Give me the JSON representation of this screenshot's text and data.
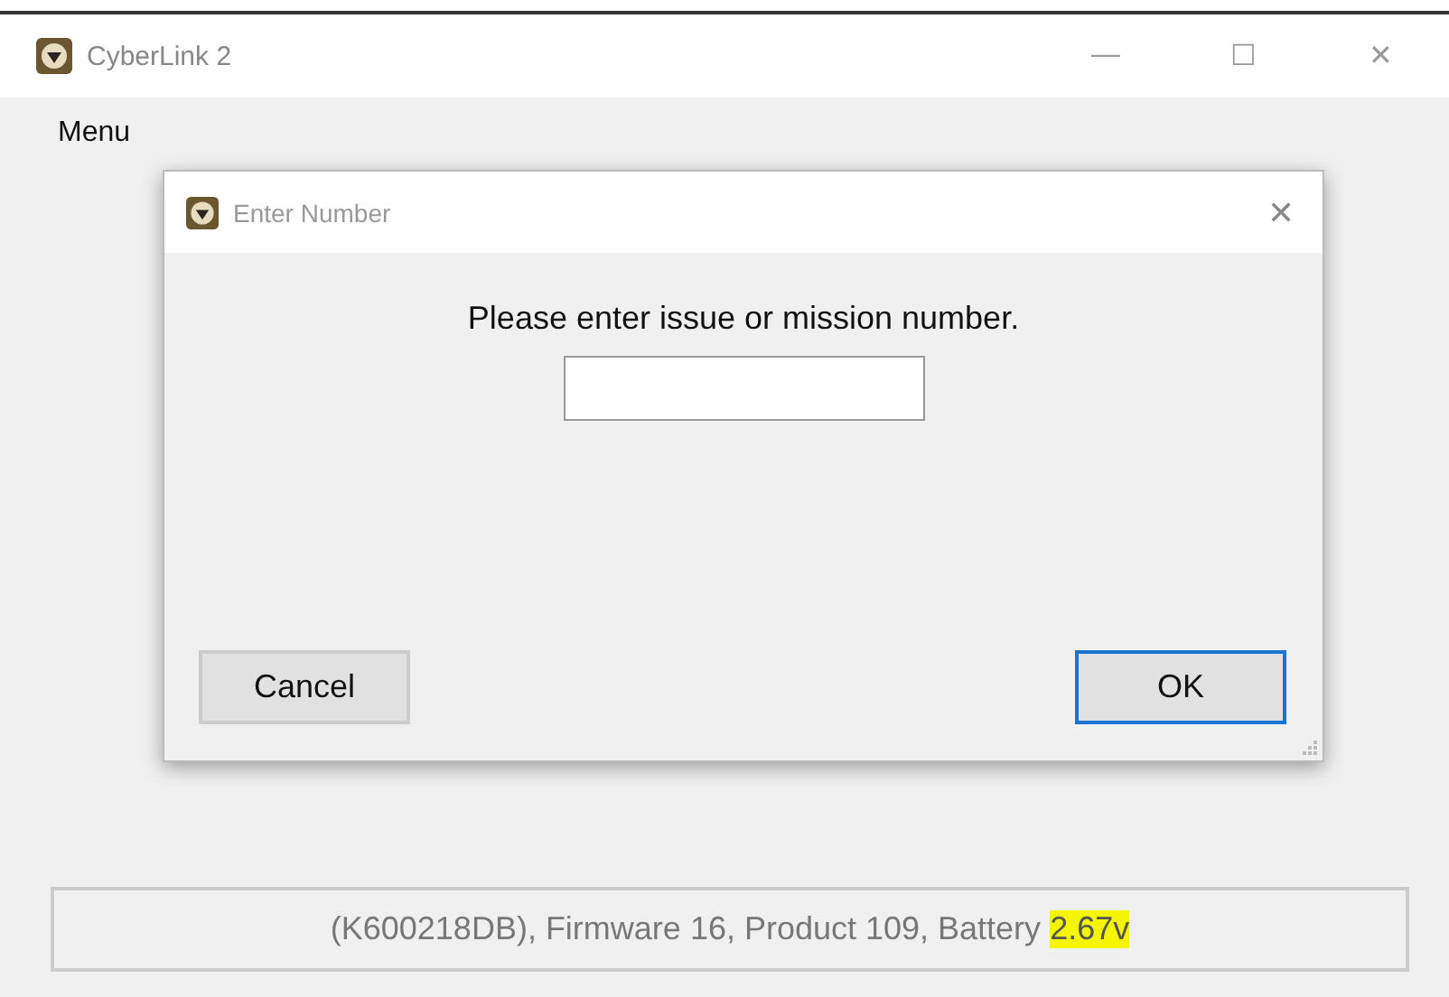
{
  "window": {
    "title": "CyberLink 2",
    "controls": [
      "—",
      "☐",
      "✕"
    ]
  },
  "menu": {
    "label": "Menu"
  },
  "dialog": {
    "title": "Enter Number",
    "close": "✕",
    "prompt": "Please enter issue or mission number.",
    "buttons": [
      {
        "label": "Cancel",
        "focused": false
      },
      {
        "label": "OK",
        "focused": true
      }
    ]
  },
  "status": {
    "segments": [
      {
        "text": "(K600218DB), Firmware 16, Product 109, Battery ",
        "highlighted": false
      },
      {
        "text": "2.67v",
        "highlighted": true
      }
    ]
  }
}
